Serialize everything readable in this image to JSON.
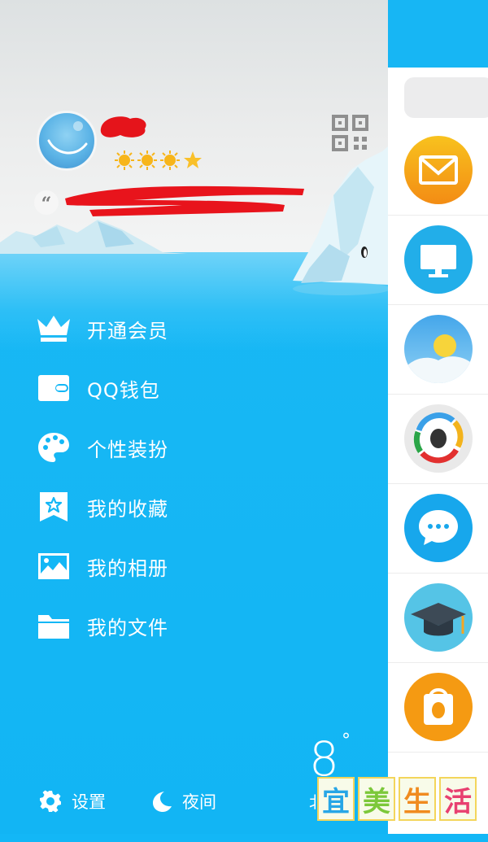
{
  "menu": {
    "items": [
      {
        "label": "开通会员",
        "icon": "crown-icon"
      },
      {
        "label": "QQ钱包",
        "icon": "wallet-icon"
      },
      {
        "label": "个性装扮",
        "icon": "palette-icon"
      },
      {
        "label": "我的收藏",
        "icon": "bookmark-star-icon"
      },
      {
        "label": "我的相册",
        "icon": "photo-icon"
      },
      {
        "label": "我的文件",
        "icon": "folder-icon"
      }
    ]
  },
  "profile": {
    "level_icons": [
      "sun-icon",
      "sun-icon",
      "sun-icon",
      "star-icon"
    ],
    "signature_quote": "“"
  },
  "bottom_bar": {
    "settings_label": "设置",
    "night_label": "夜间"
  },
  "weather": {
    "temperature": "8",
    "degree_symbol": "°",
    "city_partial": "北"
  },
  "right_panel": {
    "apps": [
      "mail-icon",
      "computer-icon",
      "weather-icon",
      "qq-news-icon",
      "chat-icon",
      "graduation-cap-icon",
      "qq-shop-icon"
    ]
  },
  "watermark": {
    "chars": [
      "宜",
      "美",
      "生",
      "活"
    ]
  },
  "colors": {
    "accent": "#13b7f6",
    "sky": "#e9eaea",
    "white": "#ffffff"
  }
}
